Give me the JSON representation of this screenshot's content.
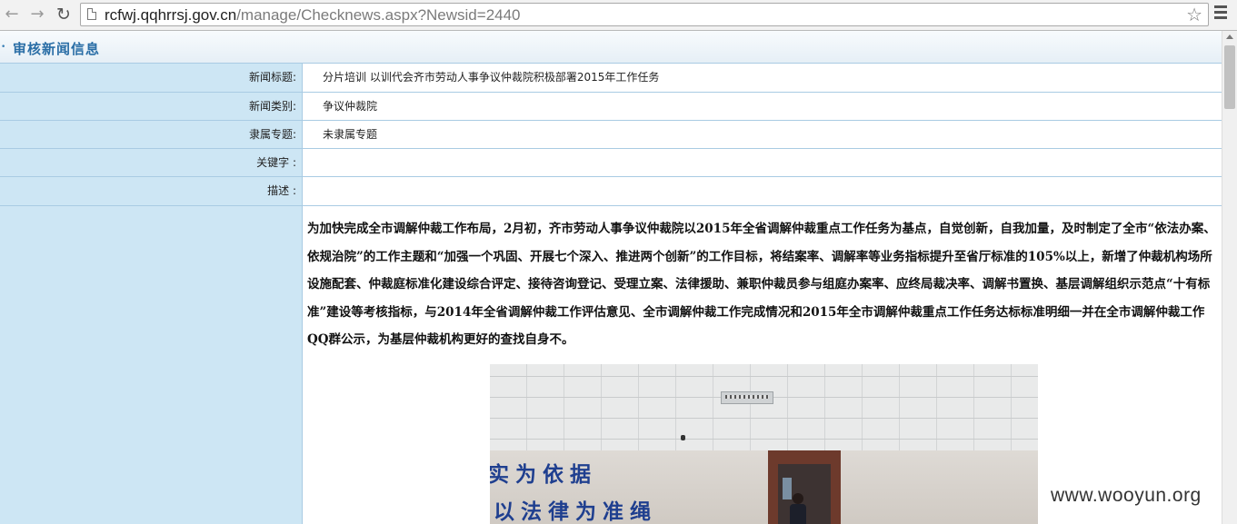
{
  "browser": {
    "url_host": "rcfwj.qqhrrsj.gov.cn",
    "url_path": "/manage/Checknews.aspx?Newsid=2440"
  },
  "section": {
    "title": "审核新闻信息"
  },
  "fields": [
    {
      "label": "新闻标题:",
      "value": "分片培训  以训代会齐市劳动人事争议仲裁院积极部署2015年工作任务"
    },
    {
      "label": "新闻类别:",
      "value": "争议仲裁院"
    },
    {
      "label": "隶属专题:",
      "value": "未隶属专题"
    },
    {
      "label": "关键字 :",
      "value": ""
    },
    {
      "label": "描述 :",
      "value": ""
    }
  ],
  "article": {
    "body": "为加快完成全市调解仲裁工作布局，2月初，齐市劳动人事争议仲裁院以2015年全省调解仲裁重点工作任务为基点，自觉创新，自我加量，及时制定了全市“依法办案、依规治院”的工作主题和“加强一个巩固、开展七个深入、推进两个创新”的工作目标，将结案率、调解率等业务指标提升至省厅标准的105%以上，新增了仲裁机构场所设施配套、仲裁庭标准化建设综合评定、接待咨询登记、受理立案、法律援助、兼职仲裁员参与组庭办案率、应终局裁决率、调解书置换、基层调解组织示范点“十有标准”建设等考核指标，与2014年全省调解仲裁工作评估意见、全市调解仲裁工作完成情况和2015年全市调解仲裁重点工作任务达标标准明细一并在全市调解仲裁工作QQ群公示，为基层仲裁机构更好的查找自身不。",
    "photo_text_line1": "实为依据",
    "photo_text_line2": "以法律为准绳"
  },
  "watermark": "www.wooyun.org"
}
